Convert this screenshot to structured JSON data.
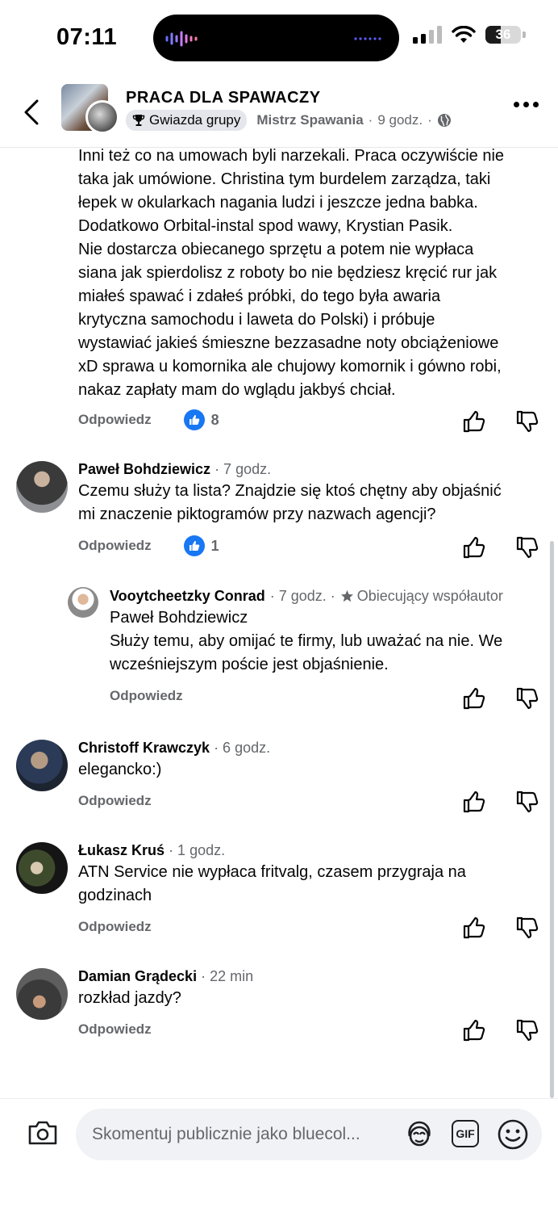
{
  "status_bar": {
    "time": "07:11",
    "battery": "36"
  },
  "header": {
    "group_name": "PRACA DLA SPAWACZY",
    "badge": "Gwiazda grupy",
    "role": "Mistrz Spawania",
    "separator": "·",
    "time": "9 godz.",
    "separator2": "·"
  },
  "post": {
    "text": "Inni też co na umowach byli narzekali. Praca oczywiście nie\ntaka jak umówione. Christina tym burdelem zarządza, taki\nłepek w okularkach nagania ludzi i jeszcze jedna babka.\nDodatkowo Orbital-instal spod wawy, Krystian Pasik.\nNie dostarcza obiecanego sprzętu a potem nie wypłaca\nsiana jak spierdolisz z roboty bo nie będziesz kręcić rur jak\nmiałeś spawać i zdałeś próbki, do tego była awaria\nkrytyczna samochodu i laweta do Polski) i próbuje\nwystawiać jakieś śmieszne bezzasadne noty obciążeniowe\nxD sprawa u komornika ale chujowy komornik i gówno robi,\nnakaz zapłaty mam do wglądu jakbyś chciał.",
    "reply_label": "Odpowiedz",
    "likes": "8"
  },
  "comments": [
    {
      "name": "Paweł Bohdziewicz",
      "time": "· 7 godz.",
      "text": "Czemu służy ta lista? Znajdzie się ktoś chętny aby objaśnić\nmi znaczenie piktogramów przy nazwach agencji?",
      "reply_label": "Odpowiedz",
      "likes": "1"
    },
    {
      "name": "Vooytcheetzky Conrad",
      "time": "· 7 godz. ·",
      "badge": "Obiecujący współautor",
      "mention": "Paweł Bohdziewicz",
      "text": "Służy temu, aby omijać te firmy, lub uważać na nie. We\nwcześniejszym poście jest objaśnienie.",
      "reply_label": "Odpowiedz"
    },
    {
      "name": "Christoff Krawczyk",
      "time": "· 6 godz.",
      "text": "elegancko:)",
      "reply_label": "Odpowiedz"
    },
    {
      "name": "Łukasz Kruś",
      "time": "· 1 godz.",
      "text": "ATN Service nie wypłaca fritvalg, czasem przygraja na\ngodzinach",
      "reply_label": "Odpowiedz"
    },
    {
      "name": "Damian Grądecki",
      "time": "· 22 min",
      "text": "rozkład jazdy?",
      "reply_label": "Odpowiedz"
    }
  ],
  "composer": {
    "placeholder": "Skomentuj publicznie jako bluecol...",
    "gif_label": "GIF"
  },
  "colors": {
    "accent": "#1877f2",
    "secondary_text": "#65676b",
    "input_bg": "#f0f2f5"
  }
}
